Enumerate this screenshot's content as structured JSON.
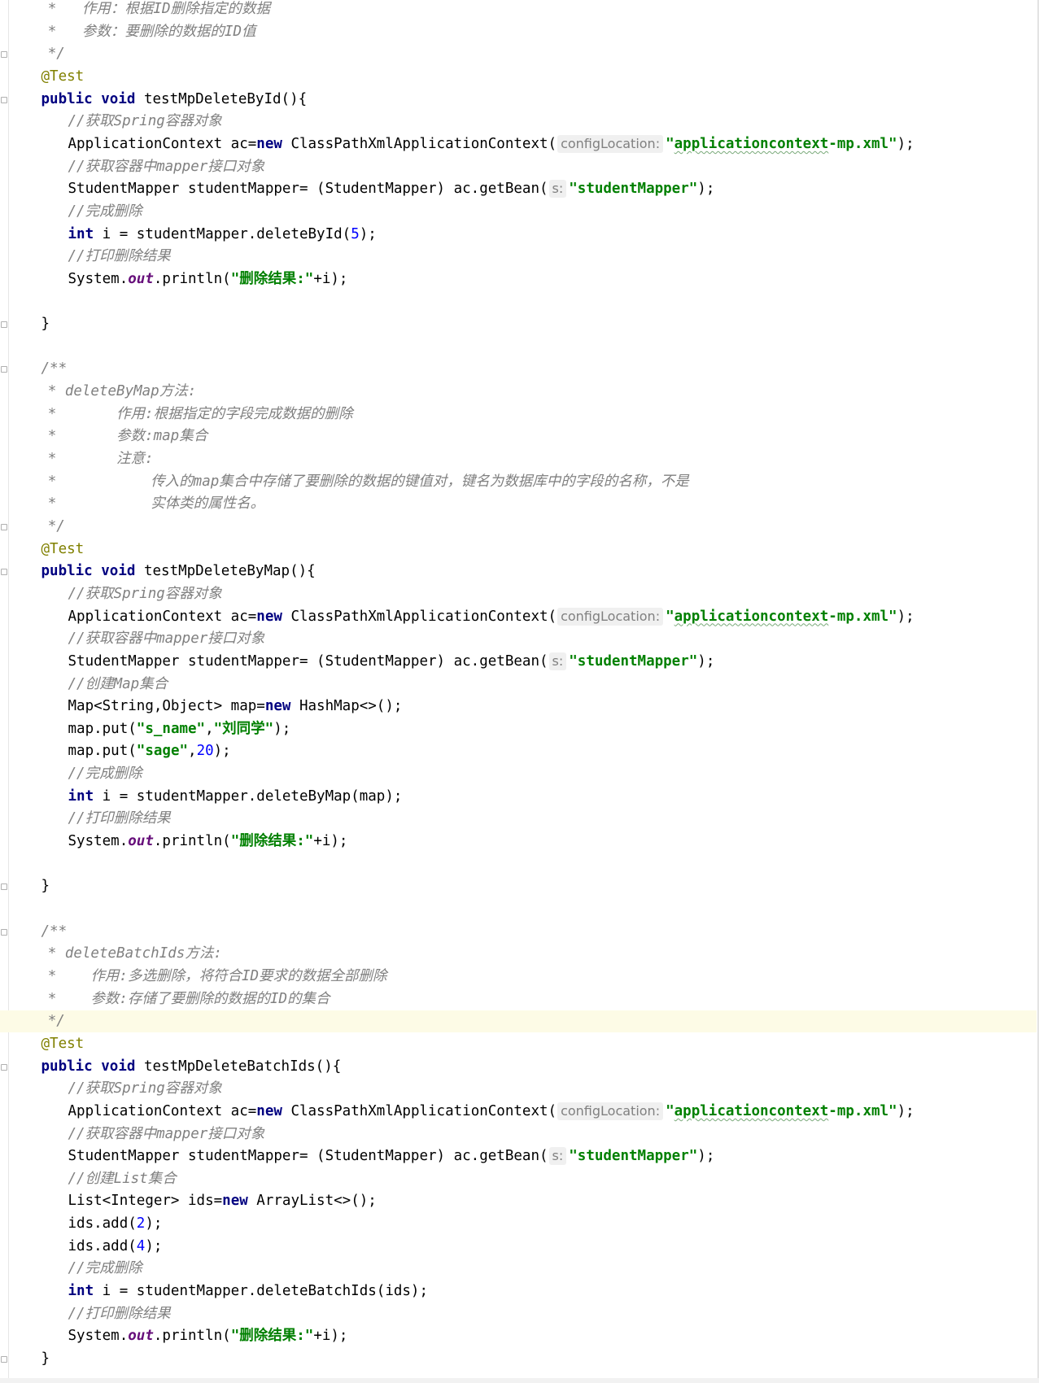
{
  "editor": {
    "lines": [
      {
        "indent": 7,
        "tokens": [
          {
            "t": "*   ",
            "c": "cmt"
          },
          {
            "t": "作用：根据ID删除指定的数据",
            "c": "cmt"
          }
        ]
      },
      {
        "indent": 7,
        "tokens": [
          {
            "t": "*   ",
            "c": "cmt"
          },
          {
            "t": "参数：要删除的数据的ID值",
            "c": "cmt"
          }
        ]
      },
      {
        "indent": 7,
        "tokens": [
          {
            "t": "*/",
            "c": "cmt"
          }
        ]
      },
      {
        "indent": 6,
        "tokens": [
          {
            "t": "@Test",
            "c": "ann"
          }
        ]
      },
      {
        "indent": 6,
        "tokens": [
          {
            "t": "public",
            "c": "kw"
          },
          {
            "t": " "
          },
          {
            "t": "void",
            "c": "kw"
          },
          {
            "t": " testMpDeleteById(){"
          }
        ]
      },
      {
        "indent": 10,
        "tokens": [
          {
            "t": "//获取Spring容器对象",
            "c": "cmt"
          }
        ]
      },
      {
        "indent": 10,
        "tokens": [
          {
            "t": "ApplicationContext ac="
          },
          {
            "t": "new",
            "c": "kw"
          },
          {
            "t": " ClassPathXmlApplicationContext("
          },
          {
            "t": "configLocation:",
            "c": "hint"
          },
          {
            "t": "\"",
            "c": "str"
          },
          {
            "t": "applicationcontext",
            "c": "str typo"
          },
          {
            "t": "-mp.xml\"",
            "c": "str"
          },
          {
            "t": ");"
          }
        ]
      },
      {
        "indent": 10,
        "tokens": [
          {
            "t": "//获取容器中mapper接口对象",
            "c": "cmt"
          }
        ]
      },
      {
        "indent": 10,
        "tokens": [
          {
            "t": "StudentMapper studentMapper= (StudentMapper) ac.getBean("
          },
          {
            "t": "s:",
            "c": "hint"
          },
          {
            "t": "\"studentMapper\"",
            "c": "str"
          },
          {
            "t": ");"
          }
        ]
      },
      {
        "indent": 10,
        "tokens": [
          {
            "t": "//完成删除",
            "c": "cmt"
          }
        ]
      },
      {
        "indent": 10,
        "tokens": [
          {
            "t": "int",
            "c": "kw"
          },
          {
            "t": " i = studentMapper.deleteById("
          },
          {
            "t": "5",
            "c": "num"
          },
          {
            "t": ");"
          }
        ]
      },
      {
        "indent": 10,
        "tokens": [
          {
            "t": "//打印删除结果",
            "c": "cmt"
          }
        ]
      },
      {
        "indent": 10,
        "tokens": [
          {
            "t": "System."
          },
          {
            "t": "out",
            "c": "field"
          },
          {
            "t": ".println("
          },
          {
            "t": "\"删除结果:\"",
            "c": "str"
          },
          {
            "t": "+i);"
          }
        ]
      },
      {
        "indent": 0,
        "tokens": []
      },
      {
        "indent": 6,
        "tokens": [
          {
            "t": "}"
          }
        ]
      },
      {
        "indent": 0,
        "tokens": []
      },
      {
        "indent": 6,
        "tokens": [
          {
            "t": "/**",
            "c": "cmt"
          }
        ]
      },
      {
        "indent": 7,
        "tokens": [
          {
            "t": "* deleteByMap方法:",
            "c": "cmt"
          }
        ]
      },
      {
        "indent": 7,
        "tokens": [
          {
            "t": "*       ",
            "c": "cmt"
          },
          {
            "t": "作用:根据指定的字段完成数据的删除",
            "c": "cmt"
          }
        ]
      },
      {
        "indent": 7,
        "tokens": [
          {
            "t": "*       ",
            "c": "cmt"
          },
          {
            "t": "参数:map集合",
            "c": "cmt"
          }
        ]
      },
      {
        "indent": 7,
        "tokens": [
          {
            "t": "*       ",
            "c": "cmt"
          },
          {
            "t": "注意:",
            "c": "cmt"
          }
        ]
      },
      {
        "indent": 7,
        "tokens": [
          {
            "t": "*           ",
            "c": "cmt"
          },
          {
            "t": "传入的map集合中存储了要删除的数据的键值对，键名为数据库中的字段的名称，不是",
            "c": "cmt"
          }
        ]
      },
      {
        "indent": 7,
        "tokens": [
          {
            "t": "*           ",
            "c": "cmt"
          },
          {
            "t": "实体类的属性名。",
            "c": "cmt"
          }
        ]
      },
      {
        "indent": 7,
        "tokens": [
          {
            "t": "*/",
            "c": "cmt"
          }
        ]
      },
      {
        "indent": 6,
        "tokens": [
          {
            "t": "@Test",
            "c": "ann"
          }
        ]
      },
      {
        "indent": 6,
        "tokens": [
          {
            "t": "public",
            "c": "kw"
          },
          {
            "t": " "
          },
          {
            "t": "void",
            "c": "kw"
          },
          {
            "t": " testMpDeleteByMap(){"
          }
        ]
      },
      {
        "indent": 10,
        "tokens": [
          {
            "t": "//获取Spring容器对象",
            "c": "cmt"
          }
        ]
      },
      {
        "indent": 10,
        "tokens": [
          {
            "t": "ApplicationContext ac="
          },
          {
            "t": "new",
            "c": "kw"
          },
          {
            "t": " ClassPathXmlApplicationContext("
          },
          {
            "t": "configLocation:",
            "c": "hint"
          },
          {
            "t": "\"",
            "c": "str"
          },
          {
            "t": "applicationcontext",
            "c": "str typo"
          },
          {
            "t": "-mp.xml\"",
            "c": "str"
          },
          {
            "t": ");"
          }
        ]
      },
      {
        "indent": 10,
        "tokens": [
          {
            "t": "//获取容器中mapper接口对象",
            "c": "cmt"
          }
        ]
      },
      {
        "indent": 10,
        "tokens": [
          {
            "t": "StudentMapper studentMapper= (StudentMapper) ac.getBean("
          },
          {
            "t": "s:",
            "c": "hint"
          },
          {
            "t": "\"studentMapper\"",
            "c": "str"
          },
          {
            "t": ");"
          }
        ]
      },
      {
        "indent": 10,
        "tokens": [
          {
            "t": "//创建Map集合",
            "c": "cmt"
          }
        ]
      },
      {
        "indent": 10,
        "tokens": [
          {
            "t": "Map<String,Object> map="
          },
          {
            "t": "new",
            "c": "kw"
          },
          {
            "t": " HashMap<>();"
          }
        ]
      },
      {
        "indent": 10,
        "tokens": [
          {
            "t": "map.put("
          },
          {
            "t": "\"s_name\"",
            "c": "str"
          },
          {
            "t": ","
          },
          {
            "t": "\"刘同学\"",
            "c": "str"
          },
          {
            "t": ");"
          }
        ]
      },
      {
        "indent": 10,
        "tokens": [
          {
            "t": "map.put("
          },
          {
            "t": "\"sage\"",
            "c": "str"
          },
          {
            "t": ","
          },
          {
            "t": "20",
            "c": "num"
          },
          {
            "t": ");"
          }
        ]
      },
      {
        "indent": 10,
        "tokens": [
          {
            "t": "//完成删除",
            "c": "cmt"
          }
        ]
      },
      {
        "indent": 10,
        "tokens": [
          {
            "t": "int",
            "c": "kw"
          },
          {
            "t": " i = studentMapper.deleteByMap(map);"
          }
        ]
      },
      {
        "indent": 10,
        "tokens": [
          {
            "t": "//打印删除结果",
            "c": "cmt"
          }
        ]
      },
      {
        "indent": 10,
        "tokens": [
          {
            "t": "System."
          },
          {
            "t": "out",
            "c": "field"
          },
          {
            "t": ".println("
          },
          {
            "t": "\"删除结果:\"",
            "c": "str"
          },
          {
            "t": "+i);"
          }
        ]
      },
      {
        "indent": 0,
        "tokens": []
      },
      {
        "indent": 6,
        "tokens": [
          {
            "t": "}"
          }
        ]
      },
      {
        "indent": 0,
        "tokens": []
      },
      {
        "indent": 6,
        "tokens": [
          {
            "t": "/**",
            "c": "cmt"
          }
        ]
      },
      {
        "indent": 7,
        "tokens": [
          {
            "t": "* deleteBatchIds方法:",
            "c": "cmt"
          }
        ]
      },
      {
        "indent": 7,
        "tokens": [
          {
            "t": "*    ",
            "c": "cmt"
          },
          {
            "t": "作用:多选删除，将符合ID要求的数据全部删除",
            "c": "cmt"
          }
        ]
      },
      {
        "indent": 7,
        "tokens": [
          {
            "t": "*    ",
            "c": "cmt"
          },
          {
            "t": "参数:存储了要删除的数据的ID的集合",
            "c": "cmt"
          }
        ]
      },
      {
        "indent": 7,
        "current": true,
        "tokens": [
          {
            "t": "*/",
            "c": "cmt"
          }
        ]
      },
      {
        "indent": 6,
        "tokens": [
          {
            "t": "@Test",
            "c": "ann"
          }
        ]
      },
      {
        "indent": 6,
        "tokens": [
          {
            "t": "public",
            "c": "kw"
          },
          {
            "t": " "
          },
          {
            "t": "void",
            "c": "kw"
          },
          {
            "t": " testMpDeleteBatchIds(){"
          }
        ]
      },
      {
        "indent": 10,
        "tokens": [
          {
            "t": "//获取Spring容器对象",
            "c": "cmt"
          }
        ]
      },
      {
        "indent": 10,
        "tokens": [
          {
            "t": "ApplicationContext ac="
          },
          {
            "t": "new",
            "c": "kw"
          },
          {
            "t": " ClassPathXmlApplicationContext("
          },
          {
            "t": "configLocation:",
            "c": "hint"
          },
          {
            "t": "\"",
            "c": "str"
          },
          {
            "t": "applicationcontext",
            "c": "str typo"
          },
          {
            "t": "-mp.xml\"",
            "c": "str"
          },
          {
            "t": ");"
          }
        ]
      },
      {
        "indent": 10,
        "tokens": [
          {
            "t": "//获取容器中mapper接口对象",
            "c": "cmt"
          }
        ]
      },
      {
        "indent": 10,
        "tokens": [
          {
            "t": "StudentMapper studentMapper= (StudentMapper) ac.getBean("
          },
          {
            "t": "s:",
            "c": "hint"
          },
          {
            "t": "\"studentMapper\"",
            "c": "str"
          },
          {
            "t": ");"
          }
        ]
      },
      {
        "indent": 10,
        "tokens": [
          {
            "t": "//创建List集合",
            "c": "cmt"
          }
        ]
      },
      {
        "indent": 10,
        "tokens": [
          {
            "t": "List<Integer> ids="
          },
          {
            "t": "new",
            "c": "kw"
          },
          {
            "t": " ArrayList<>();"
          }
        ]
      },
      {
        "indent": 10,
        "tokens": [
          {
            "t": "ids.add("
          },
          {
            "t": "2",
            "c": "num"
          },
          {
            "t": ");"
          }
        ]
      },
      {
        "indent": 10,
        "tokens": [
          {
            "t": "ids.add("
          },
          {
            "t": "4",
            "c": "num"
          },
          {
            "t": ");"
          }
        ]
      },
      {
        "indent": 10,
        "tokens": [
          {
            "t": "//完成删除",
            "c": "cmt"
          }
        ]
      },
      {
        "indent": 10,
        "tokens": [
          {
            "t": "int",
            "c": "kw"
          },
          {
            "t": " i = studentMapper.deleteBatchIds(ids);"
          }
        ]
      },
      {
        "indent": 10,
        "tokens": [
          {
            "t": "//打印删除结果",
            "c": "cmt"
          }
        ]
      },
      {
        "indent": 10,
        "tokens": [
          {
            "t": "System."
          },
          {
            "t": "out",
            "c": "field"
          },
          {
            "t": ".println("
          },
          {
            "t": "\"删除结果:\"",
            "c": "str"
          },
          {
            "t": "+i);"
          }
        ]
      },
      {
        "indent": 6,
        "tokens": [
          {
            "t": "}"
          }
        ]
      }
    ]
  }
}
